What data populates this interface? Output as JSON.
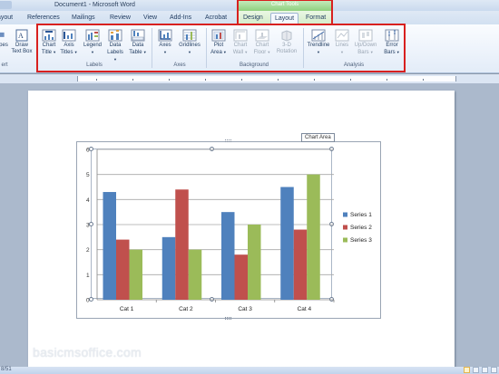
{
  "window": {
    "title": "Document1  -  Microsoft Word"
  },
  "tabs": [
    {
      "label": "ayout"
    },
    {
      "label": "References"
    },
    {
      "label": "Mailings"
    },
    {
      "label": "Review"
    },
    {
      "label": "View"
    },
    {
      "label": "Add-Ins"
    },
    {
      "label": "Acrobat"
    },
    {
      "label": "Design"
    },
    {
      "label": "Layout"
    },
    {
      "label": "Format"
    }
  ],
  "chart_tools": {
    "label": "Chart Tools"
  },
  "ribbon": {
    "partial": {
      "shapes": "pes",
      "draw": "Draw",
      "textbox": "Text Box",
      "group_frag": "ert"
    },
    "labels": {
      "group": "Labels",
      "chart_title": [
        "Chart",
        "Title"
      ],
      "axis_titles": [
        "Axis",
        "Titles"
      ],
      "legend": [
        "Legend",
        ""
      ],
      "data_labels": [
        "Data",
        "Labels"
      ],
      "data_table": [
        "Data",
        "Table"
      ]
    },
    "axes": {
      "group": "Axes",
      "axes": [
        "Axes",
        ""
      ],
      "gridlines": [
        "Gridlines",
        ""
      ]
    },
    "background": {
      "group": "Background",
      "plot_area": [
        "Plot",
        "Area"
      ],
      "chart_wall": [
        "Chart",
        "Wall"
      ],
      "chart_floor": [
        "Chart",
        "Floor"
      ],
      "rotation": [
        "3-D",
        "Rotation"
      ]
    },
    "analysis": {
      "group": "Analysis",
      "trendline": [
        "Trendline",
        ""
      ],
      "lines": [
        "Lines",
        ""
      ],
      "updown": [
        "Up/Down",
        "Bars"
      ],
      "error": [
        "Error",
        "Bars"
      ]
    }
  },
  "tooltip": "Chart Area",
  "status": {
    "left": "8/51"
  },
  "watermark": "basicmsoffice.com",
  "colors": {
    "series1": "#4f81bd",
    "series2": "#c0504d",
    "series3": "#9bbb59"
  },
  "chart_data": {
    "type": "bar",
    "categories": [
      "Cat 1",
      "Cat 2",
      "Cat 3",
      "Cat 4"
    ],
    "series": [
      {
        "name": "Series 1",
        "values": [
          4.3,
          2.5,
          3.5,
          4.5
        ]
      },
      {
        "name": "Series 2",
        "values": [
          2.4,
          4.4,
          1.8,
          2.8
        ]
      },
      {
        "name": "Series 3",
        "values": [
          2,
          2,
          3,
          5
        ]
      }
    ],
    "ylim": [
      0,
      6
    ],
    "yticks": [
      "0",
      "1",
      "2",
      "3",
      "4",
      "5",
      "6"
    ],
    "grid": true,
    "legend": "right",
    "title": "",
    "xlabel": "",
    "ylabel": ""
  }
}
